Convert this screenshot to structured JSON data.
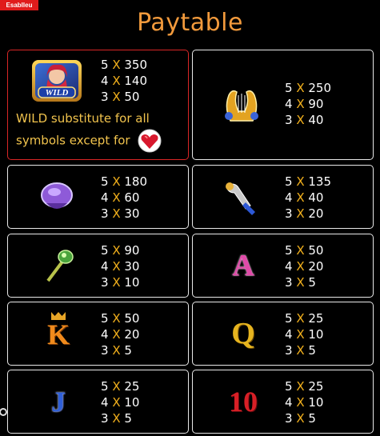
{
  "brand_tag": "Esablleu",
  "title": "Paytable",
  "wild_note": "WILD substitute for all symbols except for",
  "cards": [
    {
      "symbol": "wild-icon",
      "wild_label": "WILD",
      "payouts": [
        {
          "count": "5",
          "x": "X",
          "value": "350"
        },
        {
          "count": "4",
          "x": "X",
          "value": "140"
        },
        {
          "count": "3",
          "x": "X",
          "value": "50"
        }
      ]
    },
    {
      "symbol": "lyre-icon",
      "payouts": [
        {
          "count": "5",
          "x": "X",
          "value": "250"
        },
        {
          "count": "4",
          "x": "X",
          "value": "90"
        },
        {
          "count": "3",
          "x": "X",
          "value": "40"
        }
      ]
    },
    {
      "symbol": "purple-gem-icon",
      "payouts": [
        {
          "count": "5",
          "x": "X",
          "value": "180"
        },
        {
          "count": "4",
          "x": "X",
          "value": "60"
        },
        {
          "count": "3",
          "x": "X",
          "value": "30"
        }
      ]
    },
    {
      "symbol": "trumpet-icon",
      "payouts": [
        {
          "count": "5",
          "x": "X",
          "value": "135"
        },
        {
          "count": "4",
          "x": "X",
          "value": "40"
        },
        {
          "count": "3",
          "x": "X",
          "value": "20"
        }
      ]
    },
    {
      "symbol": "green-wand-icon",
      "payouts": [
        {
          "count": "5",
          "x": "X",
          "value": "90"
        },
        {
          "count": "4",
          "x": "X",
          "value": "30"
        },
        {
          "count": "3",
          "x": "X",
          "value": "10"
        }
      ]
    },
    {
      "symbol": "letter-a-icon",
      "letter": "A",
      "payouts": [
        {
          "count": "5",
          "x": "X",
          "value": "50"
        },
        {
          "count": "4",
          "x": "X",
          "value": "20"
        },
        {
          "count": "3",
          "x": "X",
          "value": "5"
        }
      ]
    },
    {
      "symbol": "letter-k-icon",
      "letter": "K",
      "payouts": [
        {
          "count": "5",
          "x": "X",
          "value": "50"
        },
        {
          "count": "4",
          "x": "X",
          "value": "20"
        },
        {
          "count": "3",
          "x": "X",
          "value": "5"
        }
      ]
    },
    {
      "symbol": "letter-q-icon",
      "letter": "Q",
      "payouts": [
        {
          "count": "5",
          "x": "X",
          "value": "25"
        },
        {
          "count": "4",
          "x": "X",
          "value": "10"
        },
        {
          "count": "3",
          "x": "X",
          "value": "5"
        }
      ]
    },
    {
      "symbol": "letter-j-icon",
      "letter": "J",
      "payouts": [
        {
          "count": "5",
          "x": "X",
          "value": "25"
        },
        {
          "count": "4",
          "x": "X",
          "value": "10"
        },
        {
          "count": "3",
          "x": "X",
          "value": "5"
        }
      ]
    },
    {
      "symbol": "number-10-icon",
      "letter": "10",
      "payouts": [
        {
          "count": "5",
          "x": "X",
          "value": "25"
        },
        {
          "count": "4",
          "x": "X",
          "value": "10"
        },
        {
          "count": "3",
          "x": "X",
          "value": "5"
        }
      ]
    }
  ],
  "colors": {
    "title": "#f29a3c",
    "multiplier": "#f2b01c",
    "wild_border": "#d92626",
    "card_border": "#e9e9e9"
  }
}
